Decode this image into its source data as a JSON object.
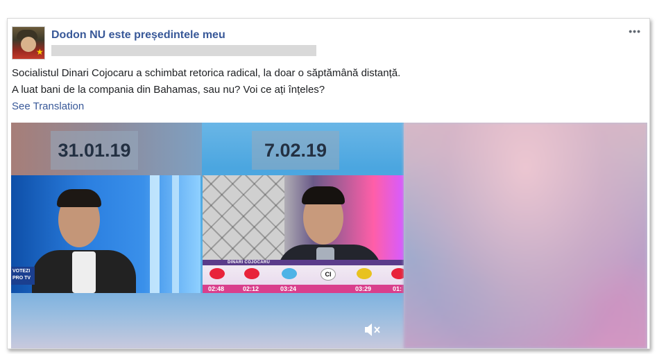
{
  "post": {
    "page_name": "Dodon NU este președintele meu",
    "text_line1": "Socialistul Dinari Cojocaru a schimbat retorica radical, la doar o săptămână distanță.",
    "text_line2": "A luat bani de la compania din Bahamas, sau nu? Voi ce ați înțeles?",
    "see_translation": "See Translation",
    "more_label": "•••"
  },
  "video": {
    "date_left": "31.01.19",
    "date_right": "7.02.19",
    "left_badge_line1": "VOTEZI",
    "left_badge_line2": "PRO TV",
    "name_tag": "DINARI COJOCARU",
    "ci_label": "CI",
    "channel_times": [
      "02:48",
      "02:12",
      "03:24",
      "03:29",
      "01:"
    ],
    "mute_icon": "muted-speaker-icon"
  },
  "colors": {
    "link": "#385898",
    "text": "#1c1e21",
    "ticker_pink": "#d93f8c"
  }
}
